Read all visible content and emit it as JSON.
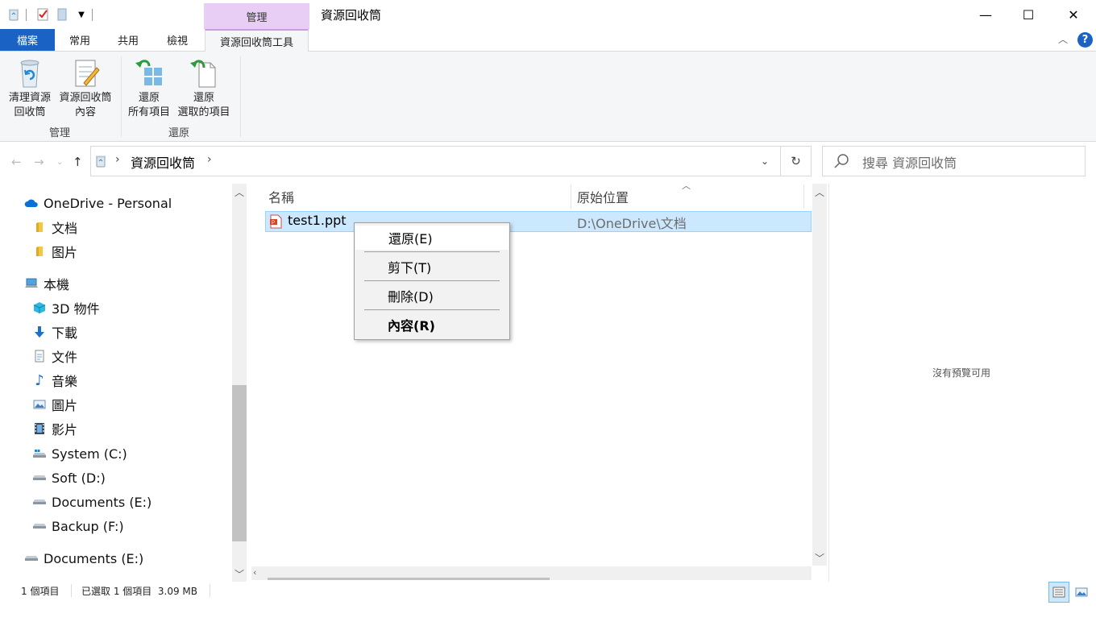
{
  "window": {
    "title": "資源回收筒",
    "contextual_header": "管理",
    "minimize": "—",
    "maximize": "☐",
    "close": "✕"
  },
  "ribbon": {
    "tabs": [
      "檔案",
      "常用",
      "共用",
      "檢視",
      "資源回收筒工具"
    ],
    "active_tab": "資源回收筒工具",
    "help": "?",
    "groups": [
      {
        "label": "管理",
        "buttons": [
          {
            "line1": "清理資源",
            "line2": "回收筒"
          },
          {
            "line1": "資源回收筒",
            "line2": "內容"
          }
        ]
      },
      {
        "label": "還原",
        "buttons": [
          {
            "line1": "還原",
            "line2": "所有項目"
          },
          {
            "line1": "還原",
            "line2": "選取的項目"
          }
        ]
      }
    ]
  },
  "address": {
    "path": "資源回收筒",
    "search_placeholder": "搜尋 資源回收筒"
  },
  "nav": {
    "items": [
      {
        "label": "OneDrive - Personal",
        "icon": "cloud-icon"
      },
      {
        "label": "文档",
        "icon": "folder-icon"
      },
      {
        "label": "图片",
        "icon": "folder-icon"
      },
      {
        "label": "本機",
        "icon": "computer-icon"
      },
      {
        "label": "3D 物件",
        "icon": "3d-objects-icon"
      },
      {
        "label": "下載",
        "icon": "download-icon"
      },
      {
        "label": "文件",
        "icon": "document-icon"
      },
      {
        "label": "音樂",
        "icon": "music-icon"
      },
      {
        "label": "圖片",
        "icon": "pictures-icon"
      },
      {
        "label": "影片",
        "icon": "video-icon"
      },
      {
        "label": "System (C:)",
        "icon": "system-drive-icon"
      },
      {
        "label": "Soft (D:)",
        "icon": "drive-icon"
      },
      {
        "label": "Documents (E:)",
        "icon": "drive-icon"
      },
      {
        "label": "Backup (F:)",
        "icon": "drive-icon"
      },
      {
        "label": "Documents (E:)",
        "icon": "drive-icon"
      }
    ]
  },
  "filelist": {
    "columns": [
      "名稱",
      "原始位置"
    ],
    "rows": [
      {
        "name": "test1.ppt",
        "location": "D:\\OneDrive\\文档",
        "selected": true
      }
    ]
  },
  "context_menu": {
    "items": [
      "還原(E)",
      "剪下(T)",
      "刪除(D)",
      "內容(R)"
    ]
  },
  "preview": {
    "message": "沒有預覽可用"
  },
  "status": {
    "item_count": "1 個項目",
    "selection": "已選取 1 個項目  3.09 MB"
  },
  "colors": {
    "accent": "#1a63c5",
    "contextual_tab": "#e8cdf5",
    "selection": "#cce8ff"
  }
}
